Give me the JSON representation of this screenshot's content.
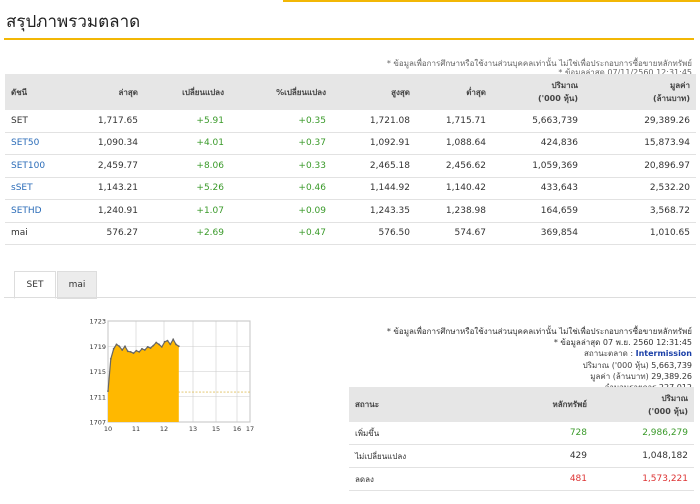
{
  "page": {
    "title": "สรุปภาพรวมตลาด",
    "disclaimer": "* ข้อมูลเพื่อการศึกษาหรือใช้งานส่วนบุคคลเท่านั้น ไม่ใช่เพื่อประกอบการซื้อขายหลักทรัพย์",
    "updated": "* ข้อมูลล่าสุด 07/11/2560 12:31:45"
  },
  "market_table": {
    "headers": [
      "ดัชนี",
      "ล่าสุด",
      "เปลี่ยนแปลง",
      "%เปลี่ยนแปลง",
      "สูงสุด",
      "ต่ำสุด",
      "ปริมาณ\n('000 หุ้น)",
      "มูลค่า\n(ล้านบาท)"
    ],
    "rows": [
      {
        "name": "SET",
        "last": "1,717.65",
        "change": "+5.91",
        "pct": "+0.35",
        "high": "1,721.08",
        "low": "1,715.71",
        "volume": "5,663,739",
        "value": "29,389.26"
      },
      {
        "name": "SET50",
        "last": "1,090.34",
        "change": "+4.01",
        "pct": "+0.37",
        "high": "1,092.91",
        "low": "1,088.64",
        "volume": "424,836",
        "value": "15,873.94"
      },
      {
        "name": "SET100",
        "last": "2,459.77",
        "change": "+8.06",
        "pct": "+0.33",
        "high": "2,465.18",
        "low": "2,456.62",
        "volume": "1,059,369",
        "value": "20,896.97"
      },
      {
        "name": "sSET",
        "last": "1,143.21",
        "change": "+5.26",
        "pct": "+0.46",
        "high": "1,144.92",
        "low": "1,140.42",
        "volume": "433,643",
        "value": "2,532.20"
      },
      {
        "name": "SETHD",
        "last": "1,240.91",
        "change": "+1.07",
        "pct": "+0.09",
        "high": "1,243.35",
        "low": "1,238.98",
        "volume": "164,659",
        "value": "3,568.72"
      },
      {
        "name": "mai",
        "last": "576.27",
        "change": "+2.69",
        "pct": "+0.47",
        "high": "576.50",
        "low": "574.67",
        "volume": "369,854",
        "value": "1,010.65"
      }
    ]
  },
  "tabs": [
    "SET",
    "mai"
  ],
  "chart_data": {
    "type": "area",
    "title": "",
    "xlabel": "",
    "ylabel": "",
    "x_ticks": [
      "10",
      "11",
      "12",
      "13",
      "15",
      "16",
      "17"
    ],
    "y_ticks": [
      1707,
      1711,
      1715,
      1719,
      1723
    ],
    "ylim": [
      1707,
      1723
    ],
    "x_range": [
      10,
      17
    ],
    "prev_close": 1711.74,
    "x": [
      10.0,
      10.1,
      10.2,
      10.3,
      10.4,
      10.5,
      10.6,
      10.7,
      10.8,
      10.9,
      11.0,
      11.1,
      11.2,
      11.3,
      11.4,
      11.5,
      11.6,
      11.7,
      11.8,
      11.9,
      12.0,
      12.1,
      12.2,
      12.3,
      12.4,
      12.5
    ],
    "y": [
      1711.9,
      1717.0,
      1718.6,
      1719.3,
      1719.0,
      1718.4,
      1719.0,
      1718.2,
      1718.1,
      1717.9,
      1718.3,
      1718.1,
      1718.6,
      1718.4,
      1718.9,
      1718.7,
      1719.1,
      1719.6,
      1719.3,
      1718.9,
      1719.7,
      1719.9,
      1719.3,
      1720.1,
      1719.3,
      1719.0
    ],
    "grid": true,
    "colors": {
      "area": "#ffb800",
      "line": "#666666",
      "prev_close": "#e0c060"
    }
  },
  "session_info": {
    "disclaimer": "* ข้อมูลเพื่อการศึกษาหรือใช้งานส่วนบุคคลเท่านั้น ไม่ใช่เพื่อประกอบการซื้อขายหลักทรัพย์",
    "updated": "* ข้อมูลล่าสุด 07 พ.ย. 2560 12:31:45",
    "status_label": "สถานะตลาด :",
    "status_value": "Intermission",
    "volume_label": "ปริมาณ ('000 หุ้น)",
    "volume_value": "5,663,739",
    "value_label": "มูลค่า (ล้านบาท)",
    "value_value": "29,389.26",
    "deals_label": "จำนวนรายการ",
    "deals_value": "227,012"
  },
  "summary_table": {
    "headers": [
      "สถานะ",
      "หลักทรัพย์",
      "ปริมาณ\n('000 หุ้น)"
    ],
    "rows": [
      {
        "status": "เพิ่มขึ้น",
        "securities": "728",
        "volume": "2,986,279",
        "tone": "up"
      },
      {
        "status": "ไม่เปลี่ยนแปลง",
        "securities": "429",
        "volume": "1,048,182",
        "tone": "flat"
      },
      {
        "status": "ลดลง",
        "securities": "481",
        "volume": "1,573,221",
        "tone": "down"
      }
    ]
  }
}
